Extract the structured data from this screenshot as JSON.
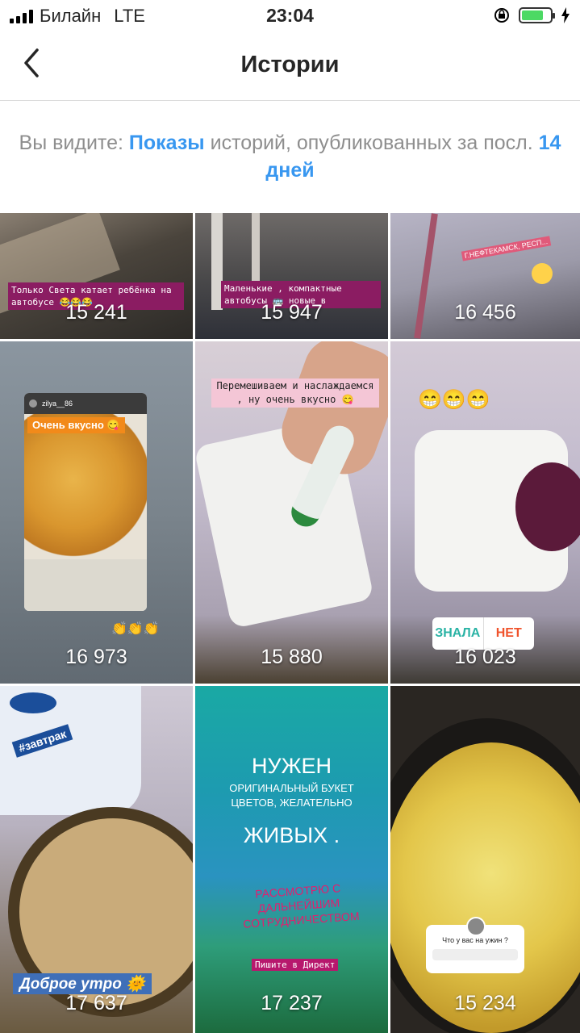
{
  "status_bar": {
    "carrier": "Билайн",
    "network": "LTE",
    "time": "23:04"
  },
  "header": {
    "title": "Истории"
  },
  "notice": {
    "prefix": "Вы видите: ",
    "metric": "Показы",
    "middle": " историй, опубликованных за посл. ",
    "period": "14 дней"
  },
  "stories": [
    {
      "count": "15 241",
      "caption": "Только Света катает ребёнка на автобусе 😂😂😂"
    },
    {
      "count": "15 947",
      "caption": "Маленькие , компактные автобусы 🚌 новые в"
    },
    {
      "count": "16 456",
      "caption": "Г.НЕФТЕКАМСК, РЕСП..."
    },
    {
      "count": "16 973",
      "caption": "Очень вкусно 😋",
      "user": "zilya__86"
    },
    {
      "count": "15 880",
      "caption": "Перемешиваем и наслаждаемся , ну очень вкусно 😋"
    },
    {
      "count": "16 023",
      "poll_yes": "ЗНАЛА",
      "poll_no": "НЕТ"
    },
    {
      "count": "17 637",
      "caption": "Доброе утро 🌞",
      "hashtag": "#завтрак"
    },
    {
      "count": "17 237",
      "line1": "НУЖЕН",
      "line2": "ОРИГИНАЛЬНЫЙ БУКЕТ ЦВЕТОВ, ЖЕЛАТЕЛЬНО",
      "line3": "ЖИВЫХ .",
      "line4": "РАССМОТРЮ С ДАЛЬНЕЙШИМ СОТРУДНИЧЕСТВОМ",
      "line5": "Пишите в Директ"
    },
    {
      "count": "15 234",
      "question": "Что у вас на ужин ?"
    }
  ]
}
